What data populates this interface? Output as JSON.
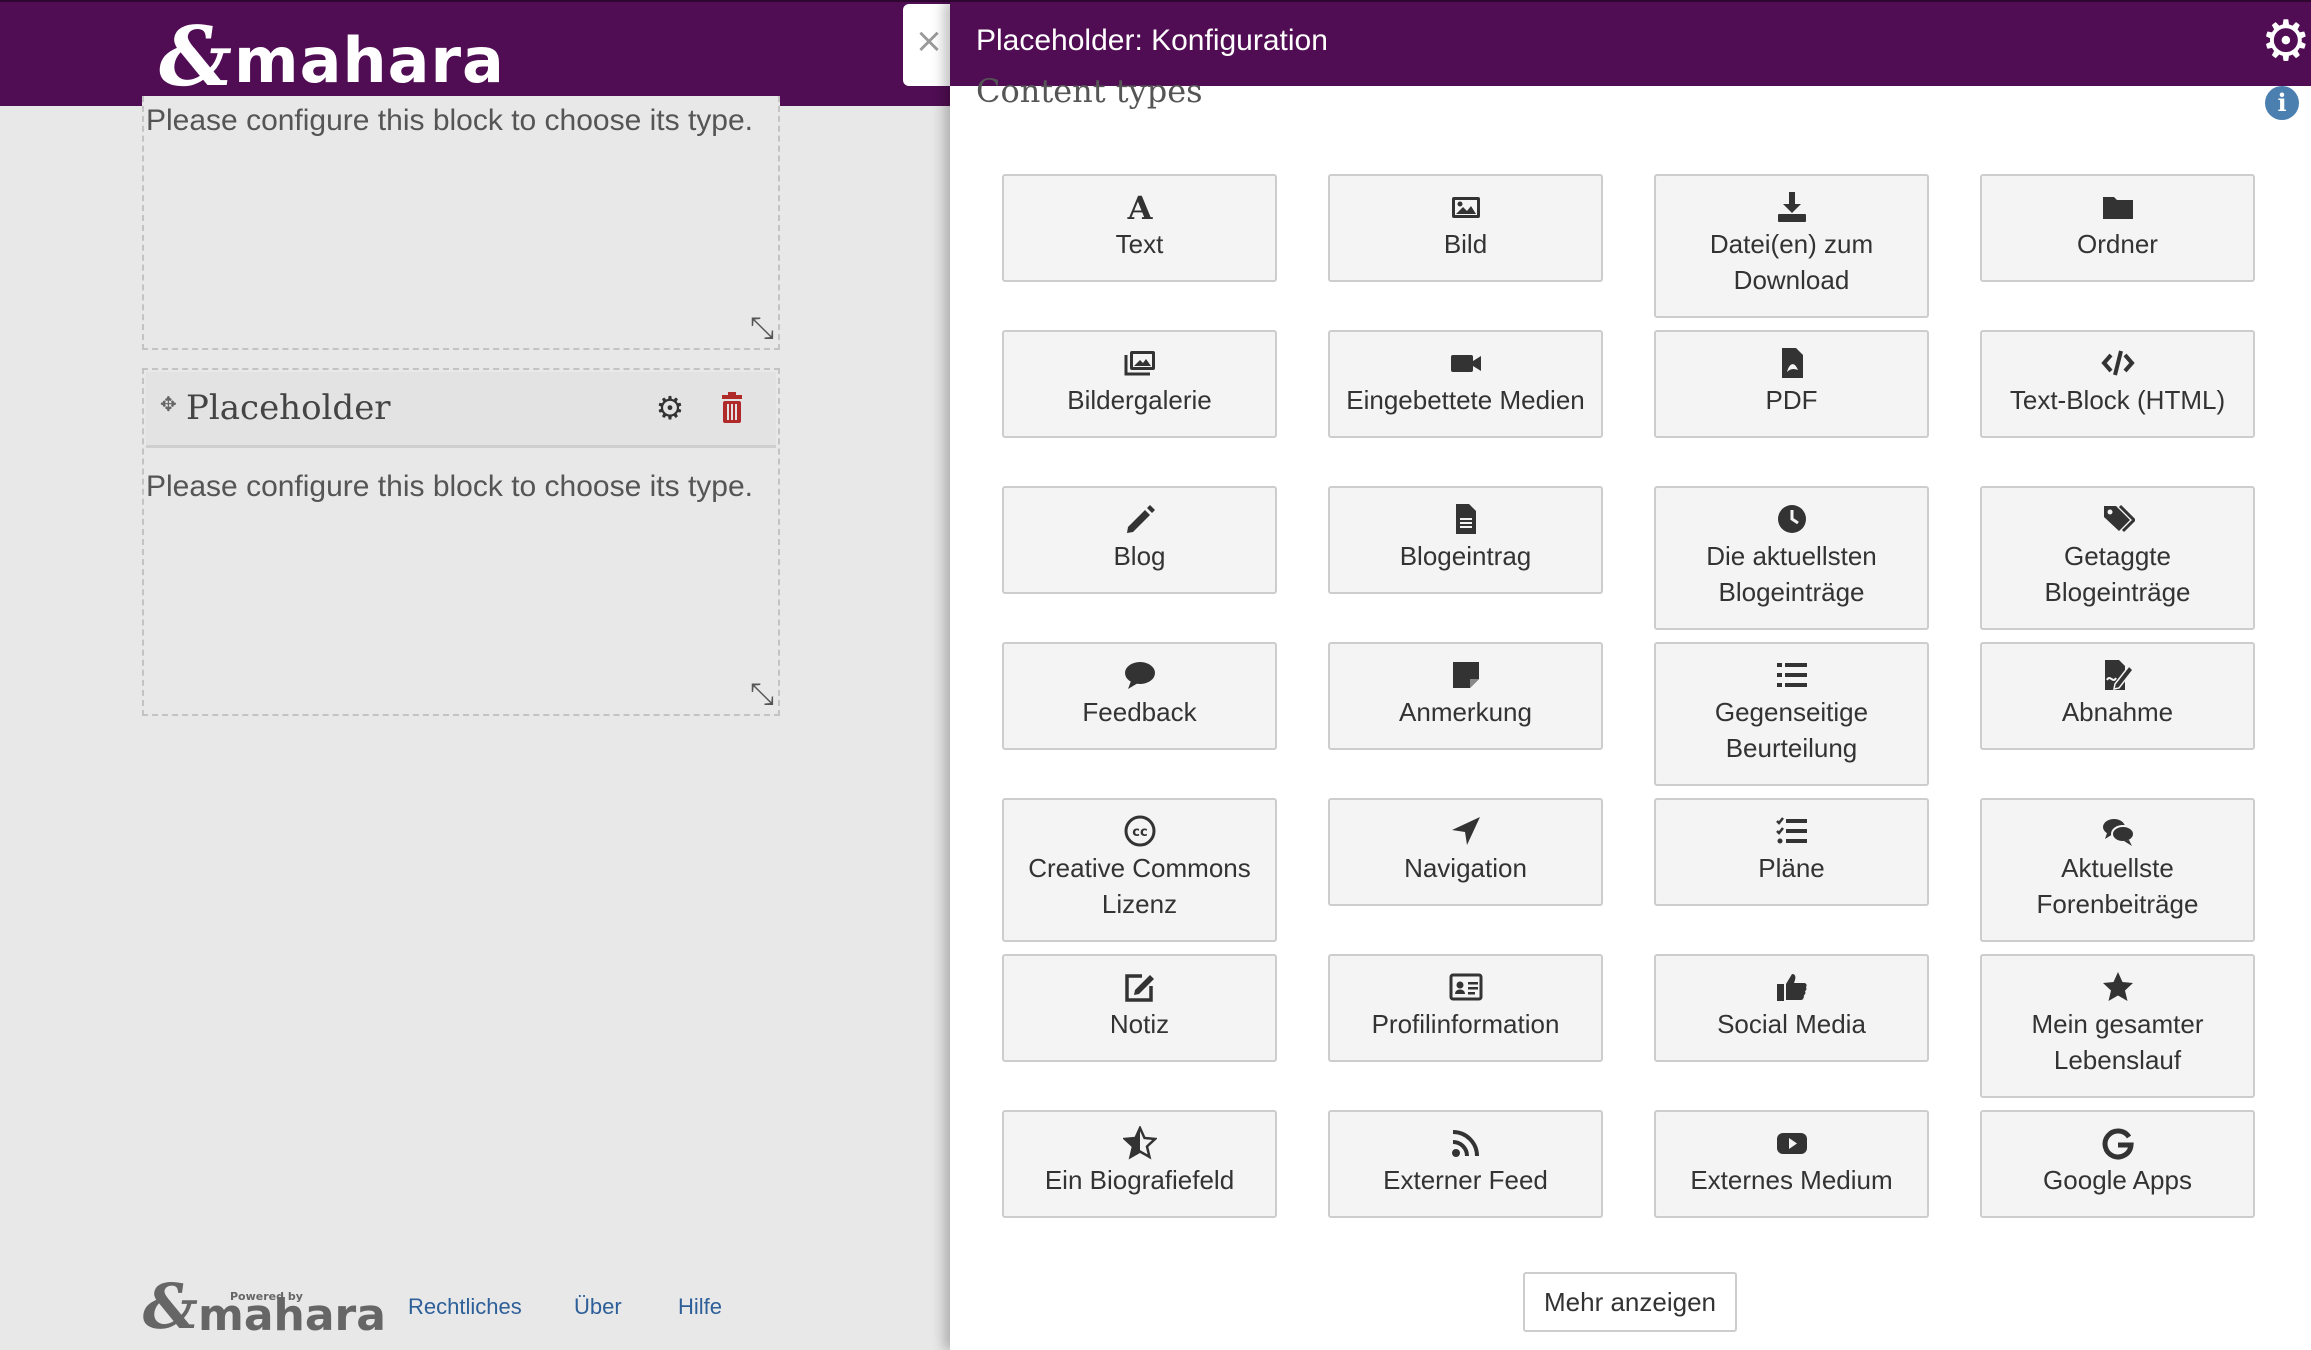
{
  "header": {
    "logo_mark": "&",
    "logo_text": "mahara"
  },
  "blocks": [
    {
      "text": "Please configure this block to choose its type."
    },
    {
      "title": "Placeholder",
      "text": "Please configure this block to choose its type."
    }
  ],
  "footer": {
    "powered_by": "Powered by",
    "logo_text": "mahara",
    "links": [
      "Rechtliches",
      "Über",
      "Hilfe"
    ]
  },
  "panel": {
    "title": "Placeholder: Konfiguration",
    "section_title": "Content types",
    "more_button": "Mehr anzeigen",
    "tiles": [
      {
        "label": "Text",
        "icon": "text-icon"
      },
      {
        "label": "Bild",
        "icon": "image-icon"
      },
      {
        "label": "Datei(en) zum Download",
        "icon": "download-icon"
      },
      {
        "label": "Ordner",
        "icon": "folder-icon"
      },
      {
        "label": "Bildergalerie",
        "icon": "gallery-icon"
      },
      {
        "label": "Eingebettete Medien",
        "icon": "video-icon"
      },
      {
        "label": "PDF",
        "icon": "pdf-icon"
      },
      {
        "label": "Text-Block (HTML)",
        "icon": "code-icon"
      },
      {
        "label": "Blog",
        "icon": "pencil-icon"
      },
      {
        "label": "Blogeintrag",
        "icon": "document-icon"
      },
      {
        "label": "Die aktuellsten Blogeinträge",
        "icon": "clock-icon"
      },
      {
        "label": "Getaggte Blogeinträge",
        "icon": "tags-icon"
      },
      {
        "label": "Feedback",
        "icon": "comment-icon"
      },
      {
        "label": "Anmerkung",
        "icon": "sticky-note-icon"
      },
      {
        "label": "Gegenseitige Beurteilung",
        "icon": "list-icon"
      },
      {
        "label": "Abnahme",
        "icon": "signature-icon"
      },
      {
        "label": "Creative Commons Lizenz",
        "icon": "creative-commons-icon"
      },
      {
        "label": "Navigation",
        "icon": "location-arrow-icon"
      },
      {
        "label": "Pläne",
        "icon": "tasks-icon"
      },
      {
        "label": "Aktuellste Forenbeiträge",
        "icon": "comments-icon"
      },
      {
        "label": "Notiz",
        "icon": "edit-icon"
      },
      {
        "label": "Profilinformation",
        "icon": "id-card-icon"
      },
      {
        "label": "Social Media",
        "icon": "thumbs-up-icon"
      },
      {
        "label": "Mein gesamter Lebenslauf",
        "icon": "star-icon"
      },
      {
        "label": "Ein Biografiefeld",
        "icon": "star-half-icon"
      },
      {
        "label": "Externer Feed",
        "icon": "rss-icon"
      },
      {
        "label": "Externes Medium",
        "icon": "youtube-icon"
      },
      {
        "label": "Google Apps",
        "icon": "google-icon"
      }
    ]
  },
  "colors": {
    "brand": "#510d54",
    "link": "#2d5f99",
    "trash": "#b02a2a",
    "info": "#4a7fb0"
  }
}
